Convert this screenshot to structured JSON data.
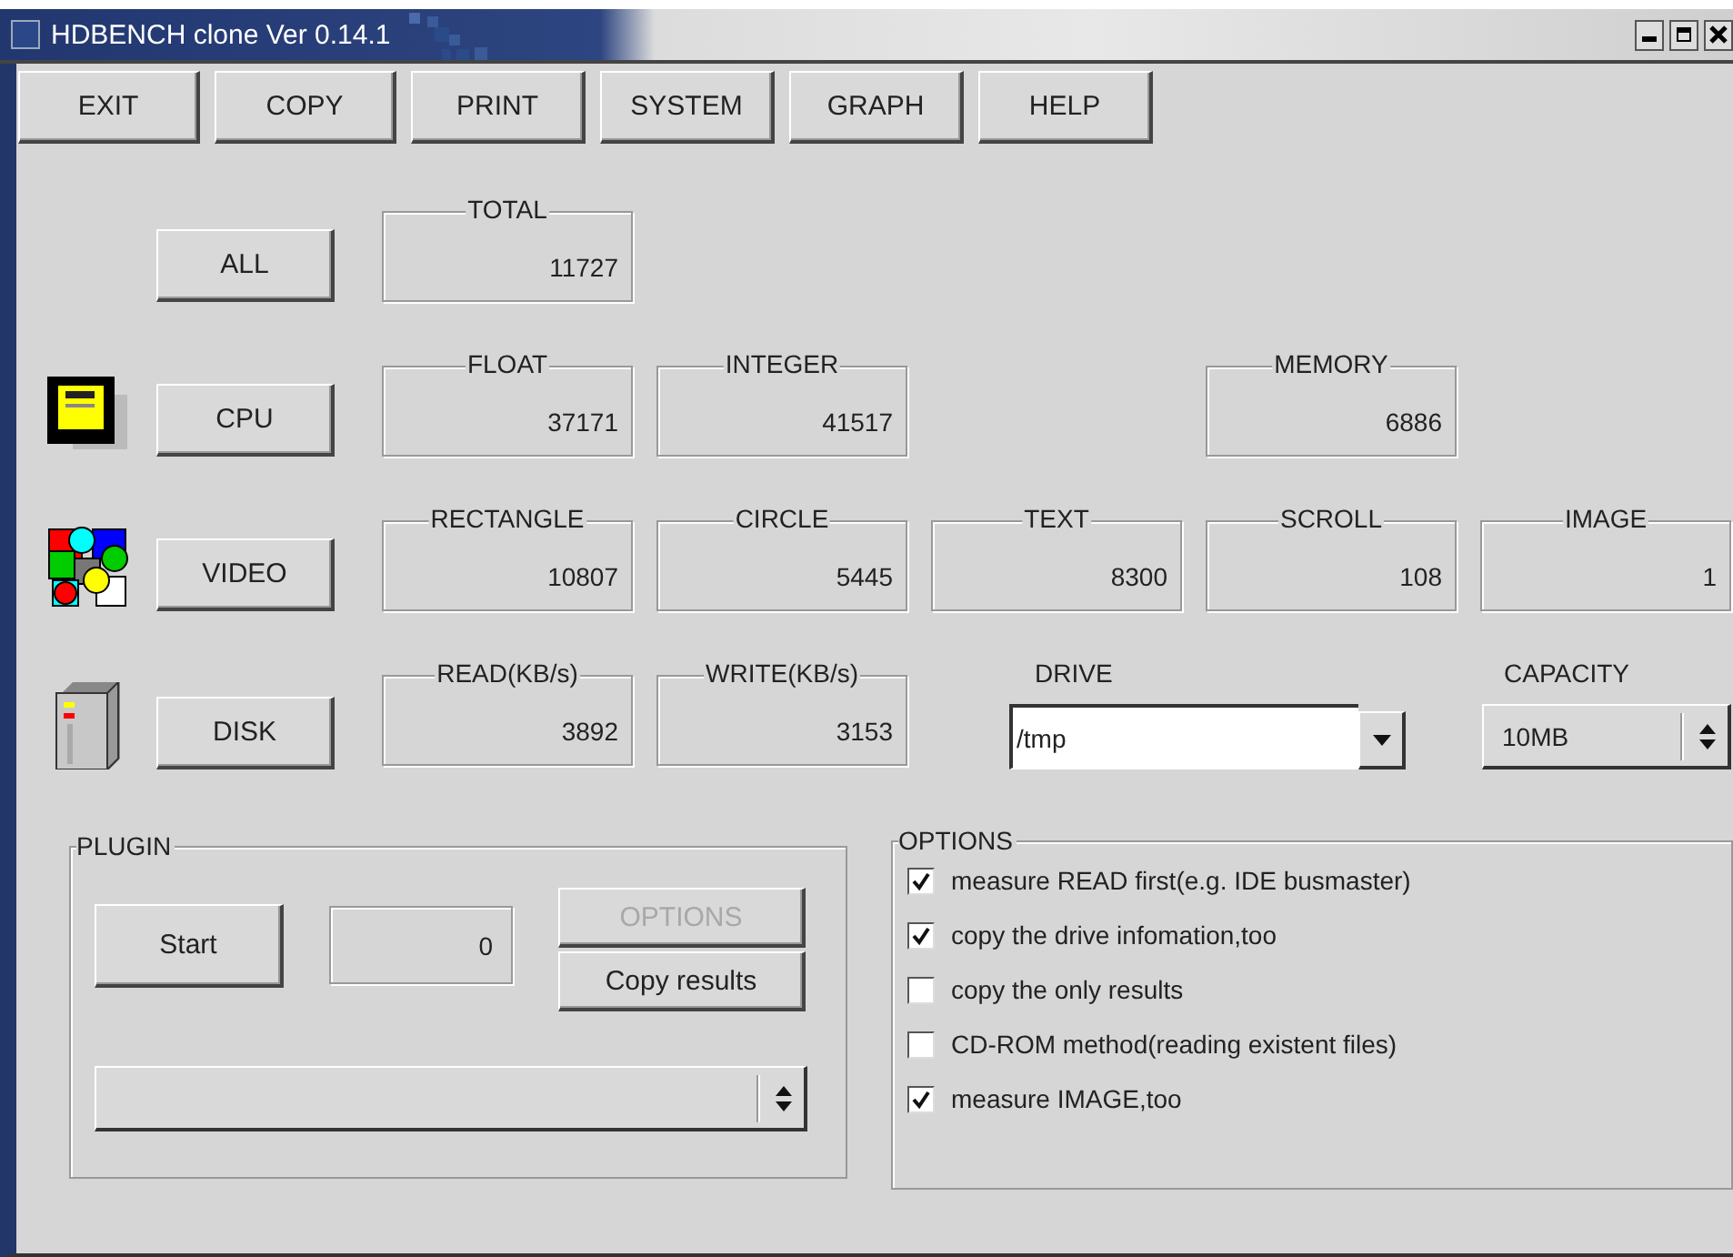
{
  "window": {
    "title": "HDBENCH clone Ver 0.14.1"
  },
  "toolbar": [
    "EXIT",
    "COPY",
    "PRINT",
    "SYSTEM",
    "GRAPH",
    "HELP"
  ],
  "rows": [
    {
      "kind": "all",
      "button": "ALL",
      "cells": [
        {
          "label": "TOTAL",
          "value": "11727"
        }
      ]
    },
    {
      "kind": "cpu",
      "button": "CPU",
      "cells": [
        {
          "label": "FLOAT",
          "value": "37171"
        },
        {
          "label": "INTEGER",
          "value": "41517"
        },
        {
          "label": "MEMORY",
          "value": "6886"
        }
      ]
    },
    {
      "kind": "video",
      "button": "VIDEO",
      "cells": [
        {
          "label": "RECTANGLE",
          "value": "10807"
        },
        {
          "label": "CIRCLE",
          "value": "5445"
        },
        {
          "label": "TEXT",
          "value": "8300"
        },
        {
          "label": "SCROLL",
          "value": "108"
        },
        {
          "label": "IMAGE",
          "value": "1"
        }
      ]
    },
    {
      "kind": "disk",
      "button": "DISK",
      "cells": [
        {
          "label": "READ(KB/s)",
          "value": "3892"
        },
        {
          "label": "WRITE(KB/s)",
          "value": "3153"
        }
      ]
    }
  ],
  "drive": {
    "label": "DRIVE",
    "value": "/tmp"
  },
  "capacity": {
    "label": "CAPACITY",
    "value": "10MB"
  },
  "plugin": {
    "title": "PLUGIN",
    "start": "Start",
    "count": "0",
    "options": {
      "label": "OPTIONS",
      "disabled": true
    },
    "copy": {
      "label": "Copy results",
      "disabled": false
    }
  },
  "options": {
    "title": "OPTIONS",
    "items": [
      {
        "label": "measure READ first(e.g. IDE busmaster)",
        "checked": true
      },
      {
        "label": "copy the drive infomation,too",
        "checked": true
      },
      {
        "label": "copy the only results",
        "checked": false
      },
      {
        "label": "CD-ROM method(reading existent files)",
        "checked": false
      },
      {
        "label": "measure IMAGE,too",
        "checked": true
      }
    ]
  }
}
